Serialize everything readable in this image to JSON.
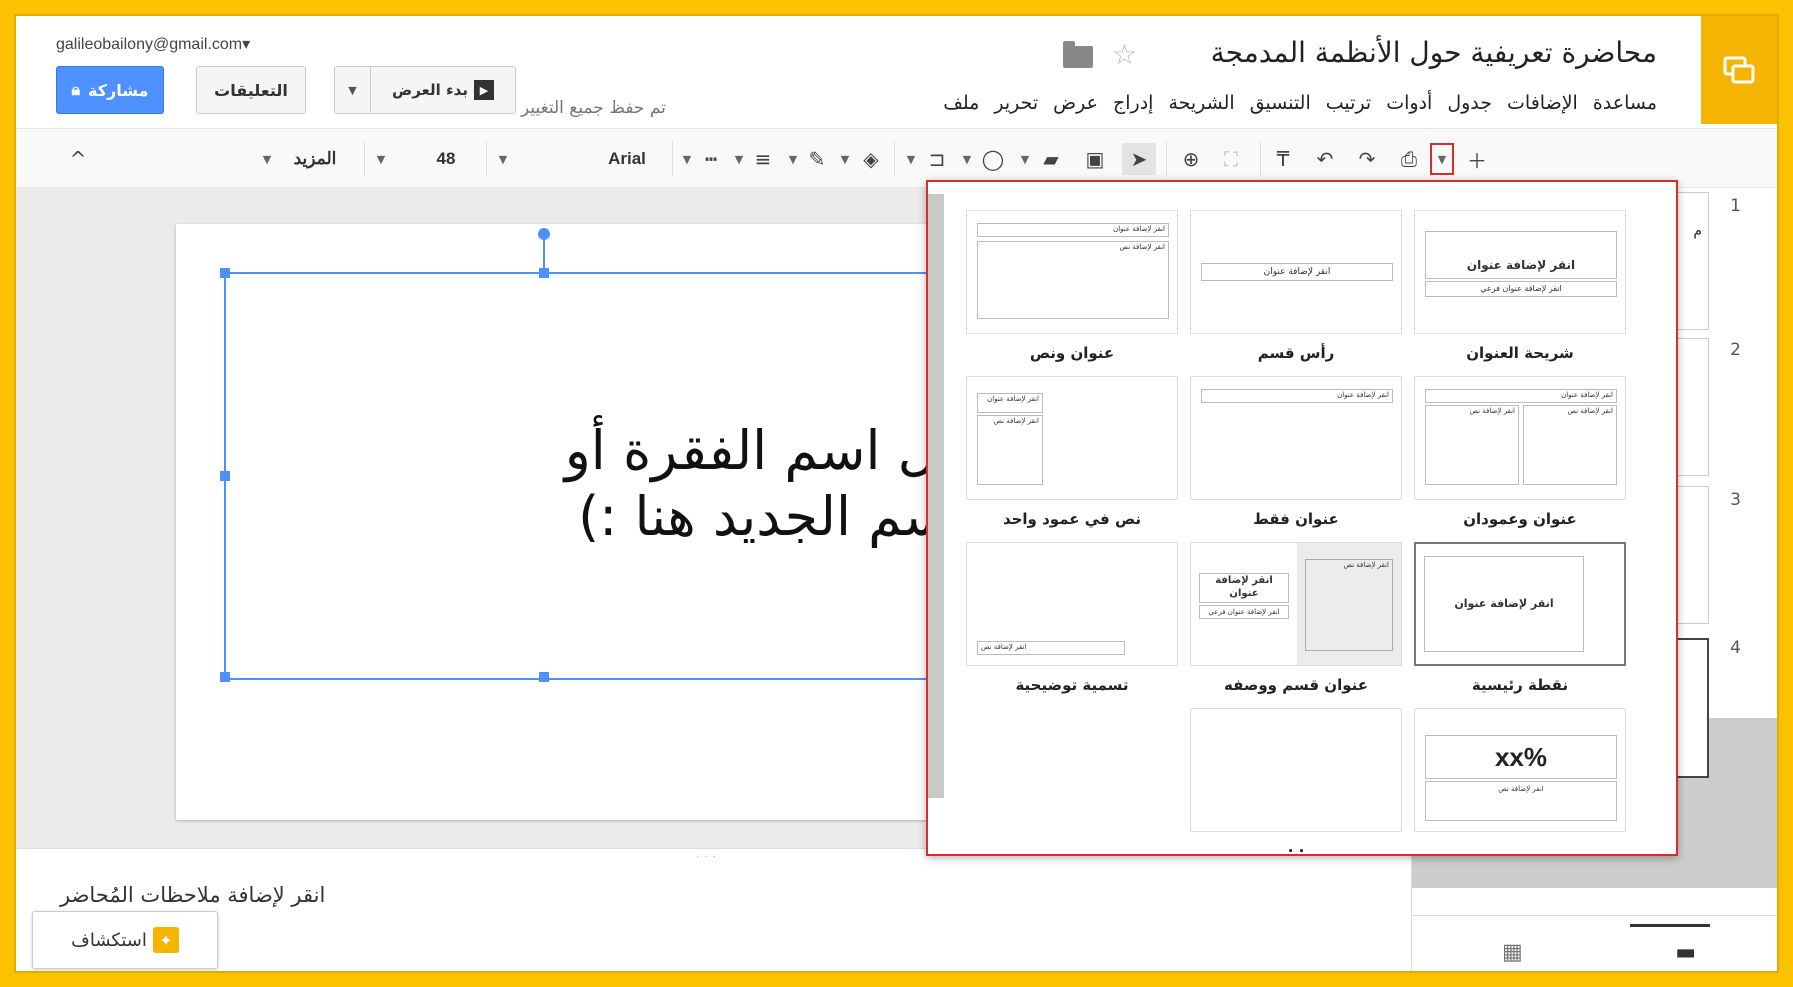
{
  "account": {
    "email": "galileobailony@gmail.com▾"
  },
  "header": {
    "doc_title": "محاضرة تعريفية حول الأنظمة المدمجة",
    "star_glyph": "☆",
    "save_status": "تم حفظ جميع التغيير",
    "share_label": "مشاركة",
    "comments_label": "التعليقات",
    "present_label": "بدء العرض"
  },
  "menu": {
    "file": "ملف",
    "edit": "تحرير",
    "view": "عرض",
    "insert": "إدراج",
    "slide": "الشريحة",
    "format": "التنسيق",
    "arrange": "ترتيب",
    "tools": "أدوات",
    "table": "جدول",
    "addons": "الإضافات",
    "help": "مساعدة"
  },
  "toolbar": {
    "font_name": "Arial",
    "font_size": "48",
    "more_label": "المزيد",
    "collapse_glyph": "^"
  },
  "slide": {
    "line1": "أدخل اسم الفقرة أو",
    "line2": "القسم الجديد هنا :)"
  },
  "notes": {
    "placeholder": "انقر لإضافة ملاحظات المُحاضر",
    "grip": "· · ·"
  },
  "explore": {
    "label": "استكشاف"
  },
  "filmstrip": {
    "numbers": [
      "1",
      "2",
      "3",
      "4"
    ],
    "thumb1_text": "م"
  },
  "layouts": {
    "title_slide": {
      "label": "شريحة العنوان",
      "title": "انقر لإضافة عنوان",
      "subtitle": "انقر لإضافة عنوان فرعي"
    },
    "section_header": {
      "label": "رأس قسم",
      "title": "انقر لإضافة عنوان"
    },
    "title_body": {
      "label": "عنوان ونص",
      "title": "انقر لإضافة عنوان",
      "body": "انقر لإضافة نص"
    },
    "title_two_columns": {
      "label": "عنوان وعمودان",
      "title": "انقر لإضافة عنوان",
      "col_a": "انقر لإضافة نص",
      "col_b": "انقر لإضافة نص"
    },
    "title_only": {
      "label": "عنوان فقط",
      "title": "انقر لإضافة عنوان"
    },
    "one_column_text": {
      "label": "نص في عمود واحد",
      "title": "انقر لإضافة عنوان",
      "body": "انقر لإضافة نص"
    },
    "main_point": {
      "label": "نقطة رئيسية",
      "title": "انقر لإضافة عنوان"
    },
    "section_title_description": {
      "label": "عنوان قسم ووصفه",
      "title_line1": "انقر لإضافة",
      "title_line2": "عنوان",
      "subtitle": "انقر لإضافة عنوان فرعي",
      "body": "انقر لإضافة نص"
    },
    "caption": {
      "label": "تسمية توضيحية",
      "body": "انقر لإضافة نص"
    },
    "big_number": {
      "label": "ـ",
      "number": "xx%",
      "body": "انقر لإضافة نص"
    },
    "blank": {
      "label": "· ·"
    }
  },
  "colors": {
    "frame": "#fcc200",
    "accent_blue": "#4d90fe",
    "app_yellow": "#f4b400",
    "highlight_red": "#d32f2f"
  },
  "icons": [
    "slides-logo-icon",
    "folder-icon",
    "star-icon",
    "lock-icon",
    "play-icon",
    "add-icon",
    "chevron-down-icon",
    "print-icon",
    "redo-icon",
    "undo-icon",
    "paint-format-icon",
    "zoom-fit-icon",
    "zoom-icon",
    "pointer-icon",
    "text-box-icon",
    "image-icon",
    "shape-icon",
    "line-icon",
    "fill-color-icon",
    "border-color-icon",
    "border-weight-icon",
    "border-dash-icon",
    "collapse-icon",
    "grid-view-icon",
    "filmstrip-view-icon",
    "explore-icon"
  ]
}
